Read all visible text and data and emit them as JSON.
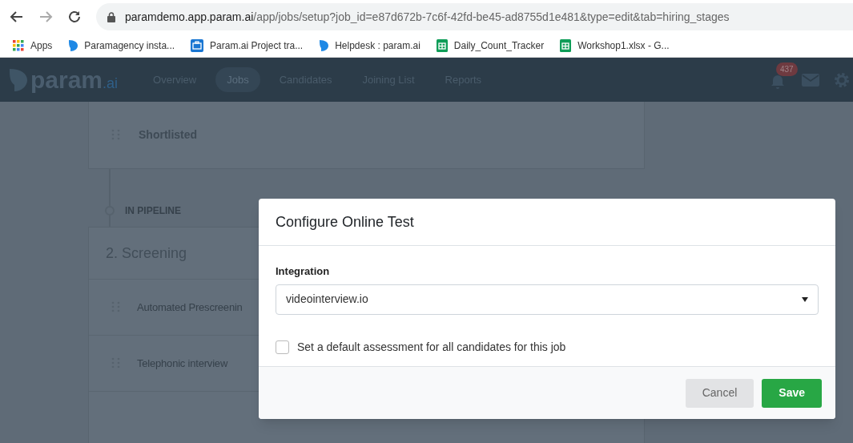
{
  "browser": {
    "url_host": "paramdemo.app.param.ai",
    "url_path": "/app/jobs/setup?job_id=e87d672b-7c6f-42fd-be45-ad8755d1e481&type=edit&tab=hiring_stages",
    "bookmarks": [
      {
        "label": "Apps",
        "kind": "apps"
      },
      {
        "label": "Paramagency insta...",
        "kind": "param"
      },
      {
        "label": "Param.ai Project tra...",
        "kind": "briefcase"
      },
      {
        "label": "Helpdesk : param.ai",
        "kind": "param"
      },
      {
        "label": "Daily_Count_Tracker",
        "kind": "sheet"
      },
      {
        "label": "Workshop1.xlsx - G...",
        "kind": "sheet"
      }
    ]
  },
  "nav": {
    "logo": {
      "main": "param",
      "suffix": ".ai"
    },
    "items": [
      {
        "label": "Overview",
        "selected": false
      },
      {
        "label": "Jobs",
        "selected": true
      },
      {
        "label": "Candidates",
        "selected": false
      },
      {
        "label": "Joining List",
        "selected": false
      },
      {
        "label": "Reports",
        "selected": false
      }
    ],
    "notification_count": "437"
  },
  "top_stage": {
    "label": "Shortlisted"
  },
  "pipeline_label": "IN PIPELINE",
  "screening": {
    "title": "2. Screening",
    "stages": [
      {
        "label": "Automated Prescreenin"
      },
      {
        "label": "Telephonic interview"
      }
    ]
  },
  "modal": {
    "title": "Configure Online Test",
    "field_label": "Integration",
    "select_value": "videointerview.io",
    "checkbox": {
      "label": "Set a default assessment for all candidates for this job",
      "checked": false
    },
    "buttons": [
      {
        "label": "Cancel",
        "kind": "secondary"
      },
      {
        "label": "Save",
        "kind": "primary"
      }
    ]
  }
}
